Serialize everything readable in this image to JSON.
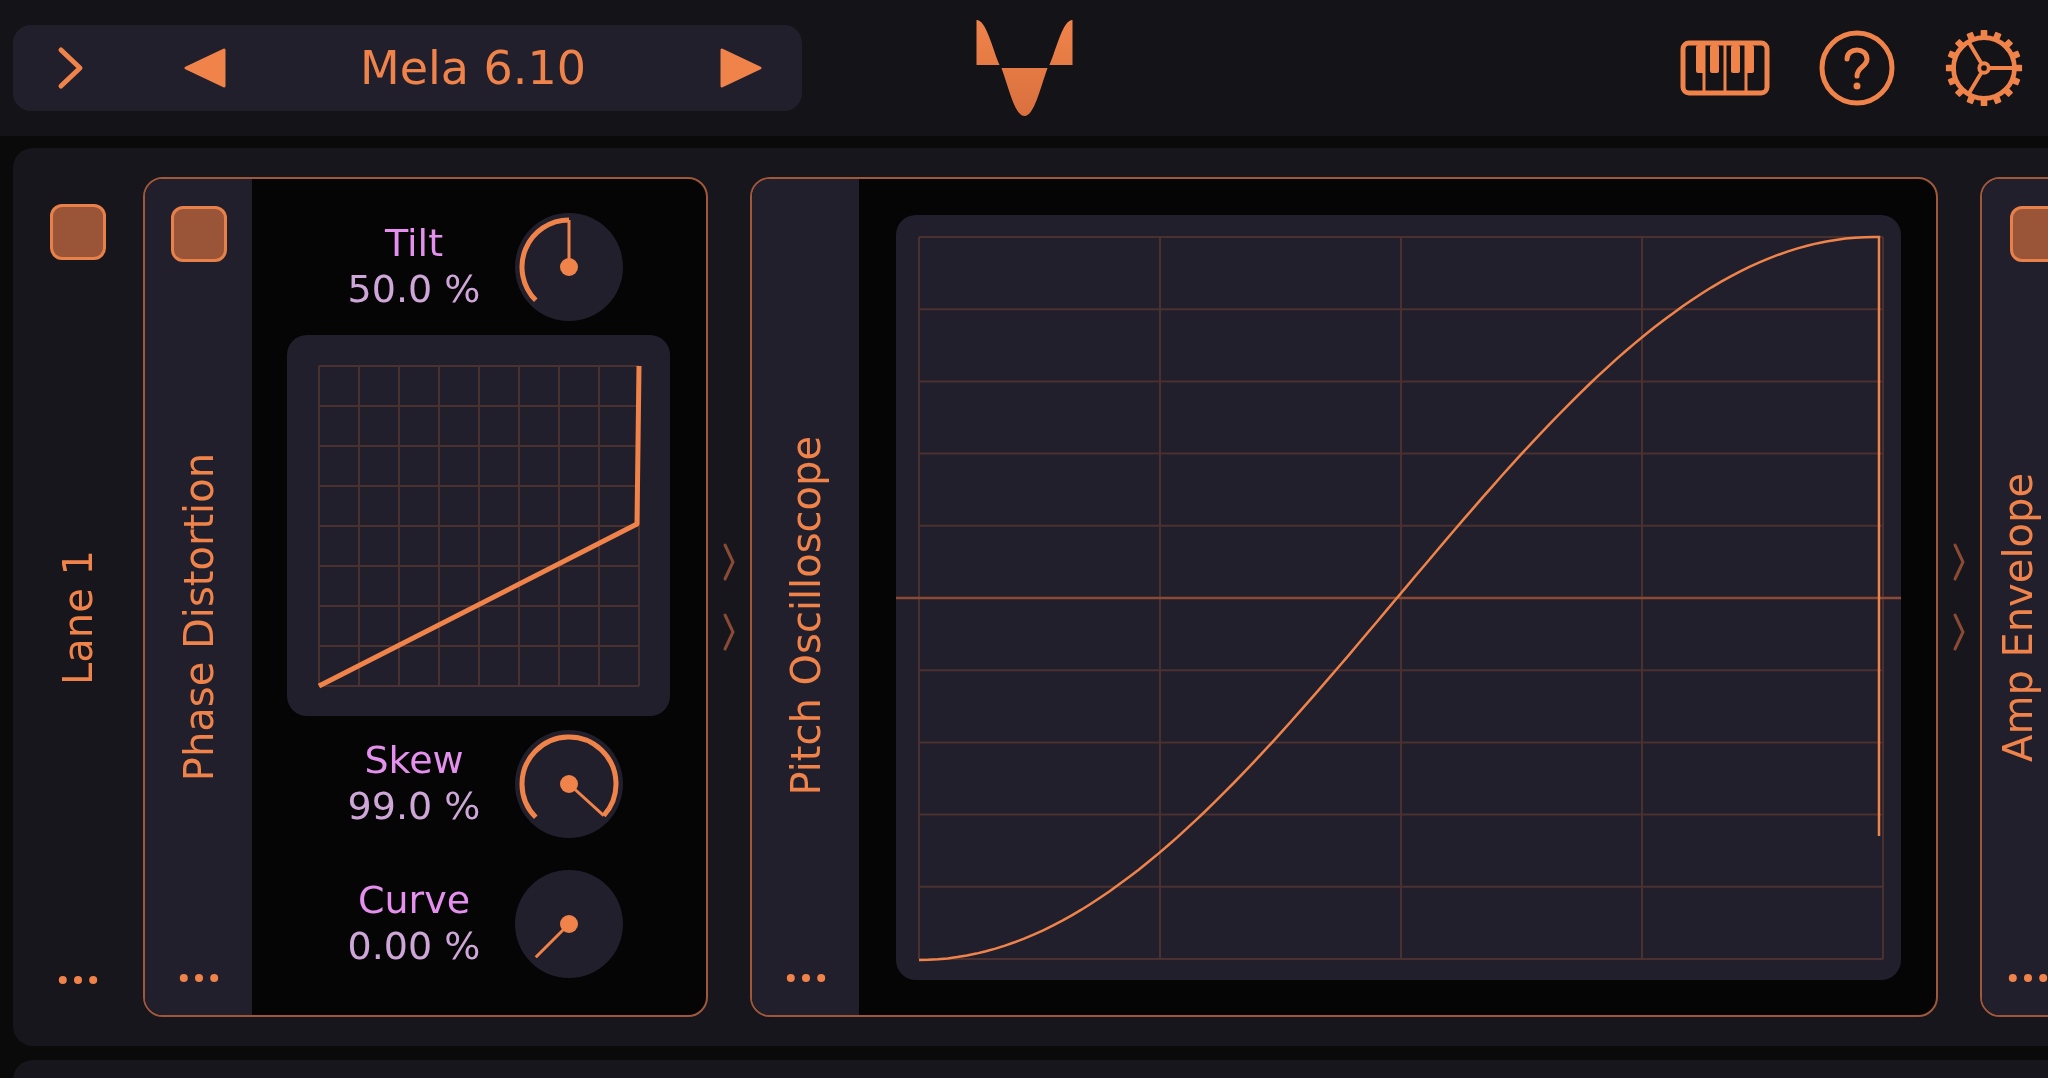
{
  "preset": {
    "name": "Mela 6.10"
  },
  "lane": {
    "title": "Lane 1",
    "on": true
  },
  "modules": [
    {
      "kind": "phase_distortion",
      "title": "Phase Distortion",
      "on": true,
      "knobs": [
        {
          "label": "Tilt",
          "value": "50.0 %"
        },
        {
          "label": "Skew",
          "value": "99.0 %"
        },
        {
          "label": "Curve",
          "value": "0.00 %"
        }
      ]
    },
    {
      "kind": "oscilloscope",
      "title": "Pitch Oscilloscope"
    },
    {
      "kind": "envelope",
      "title": "Amp Envelope",
      "on": true
    }
  ]
}
